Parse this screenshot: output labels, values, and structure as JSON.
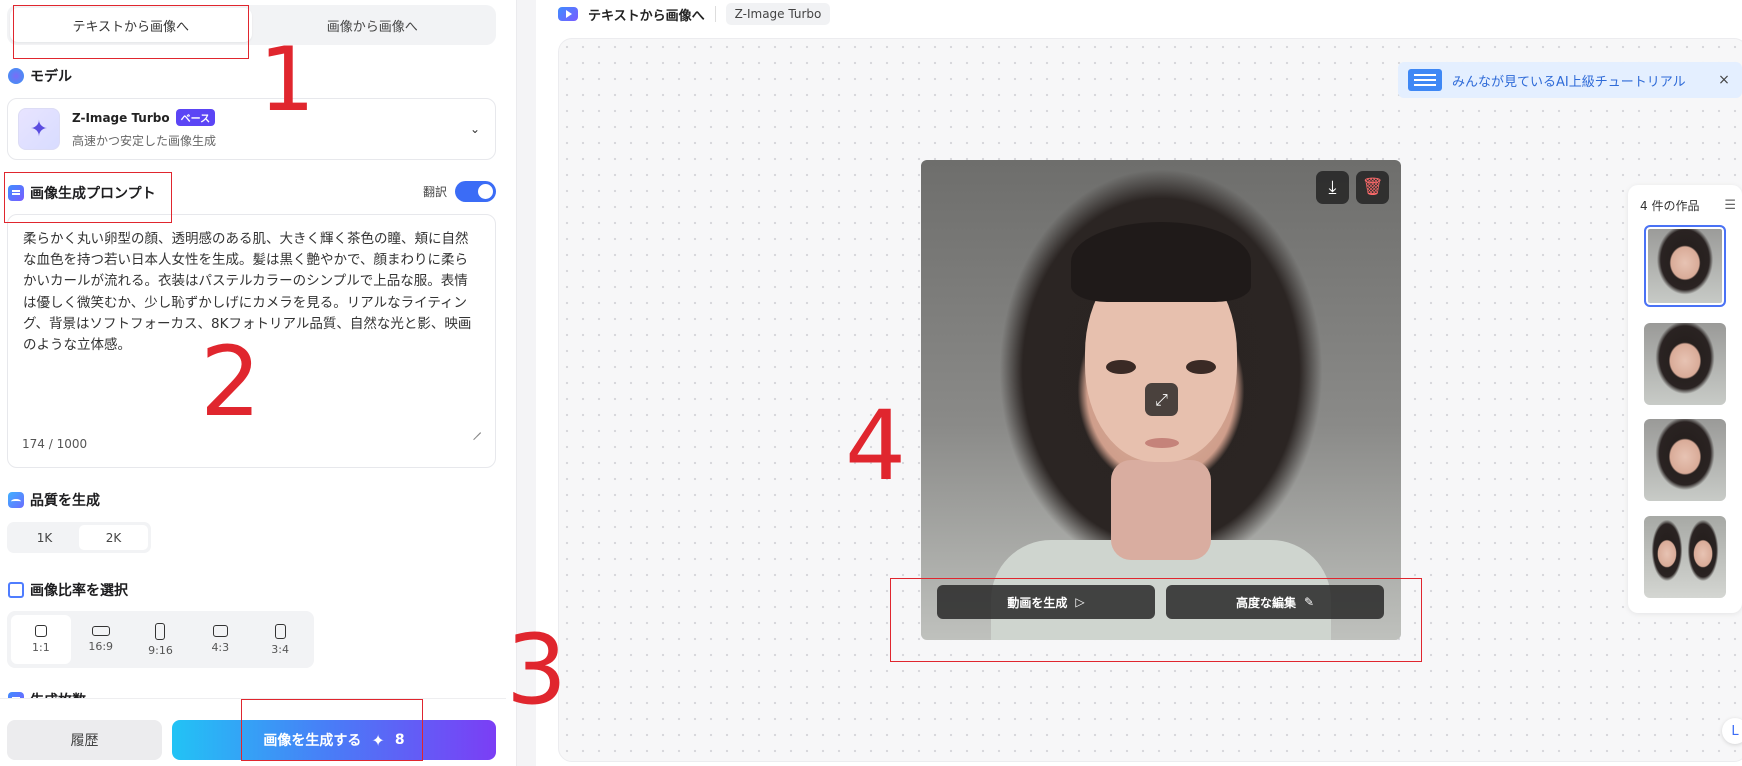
{
  "left_panel": {
    "tabs": [
      {
        "label": "テキストから画像へ",
        "active": true
      },
      {
        "label": "画像から画像へ",
        "active": false
      }
    ],
    "model": {
      "section_title": "モデル",
      "name": "Z-Image Turbo",
      "badge": "ベース",
      "description": "高速かつ安定した画像生成"
    },
    "prompt": {
      "section_title": "画像生成プロンプト",
      "translate_label": "翻訳",
      "translate_on": true,
      "text": "柔らかく丸い卵型の顔、透明感のある肌、大きく輝く茶色の瞳、頬に自然な血色を持つ若い日本人女性を生成。髪は黒く艶やかで、顔まわりに柔らかいカールが流れる。衣装はパステルカラーのシンプルで上品な服。表情は優しく微笑むか、少し恥ずかしげにカメラを見る。リアルなライティング、背景はソフトフォーカス、8Kフォトリアル品質、自然な光と影、映画のような立体感。",
      "counter": "174 / 1000"
    },
    "quality": {
      "section_title": "品質を生成",
      "options": [
        "1K",
        "2K"
      ],
      "selected": "2K"
    },
    "ratio": {
      "section_title": "画像比率を選択",
      "options": [
        "1:1",
        "16:9",
        "9:16",
        "4:3",
        "3:4"
      ],
      "selected": "1:1"
    },
    "next_section_title": "生成枚数",
    "history_label": "履歴",
    "generate_label": "画像を生成する",
    "generate_cost": "8"
  },
  "header": {
    "title": "テキストから画像へ",
    "model_chip": "Z-Image Turbo"
  },
  "tutorial": {
    "text": "みんなが見ているAI上級チュートリアル",
    "close": "×"
  },
  "image_actions": {
    "video_label": "動画を生成",
    "edit_label": "高度な編集"
  },
  "gallery": {
    "title": "4 件の作品",
    "count": 4
  },
  "annotations": [
    "1",
    "2",
    "3",
    "4"
  ],
  "colors": {
    "accent": "#3b6cf6",
    "annotation": "#e0262e",
    "generate_gradient_start": "#22c3f5",
    "generate_gradient_end": "#7b3ef5"
  }
}
